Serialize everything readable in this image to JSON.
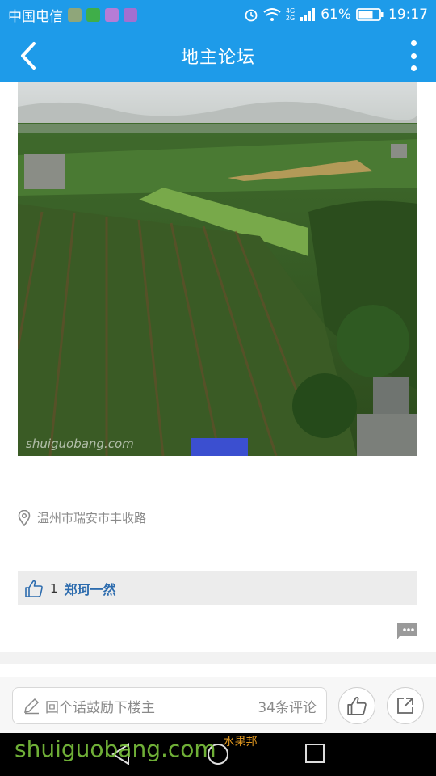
{
  "status_bar": {
    "carrier": "中国电信",
    "battery": "61%",
    "network": "4G",
    "network2": "2G",
    "time": "19:17"
  },
  "header": {
    "title": "地主论坛"
  },
  "post": {
    "photo_watermark": "shuiguobang.com",
    "location": "温州市瑞安市丰收路",
    "likes_count": "1",
    "liked_by": "郑珂一然"
  },
  "comment_bar": {
    "placeholder": "回个话鼓励下楼主",
    "comment_count": "34条评论"
  },
  "watermark": {
    "text": "shuiguobang.com",
    "brand": "水果邦"
  },
  "colors": {
    "accent": "#1e9be9",
    "link": "#2d6cae"
  }
}
